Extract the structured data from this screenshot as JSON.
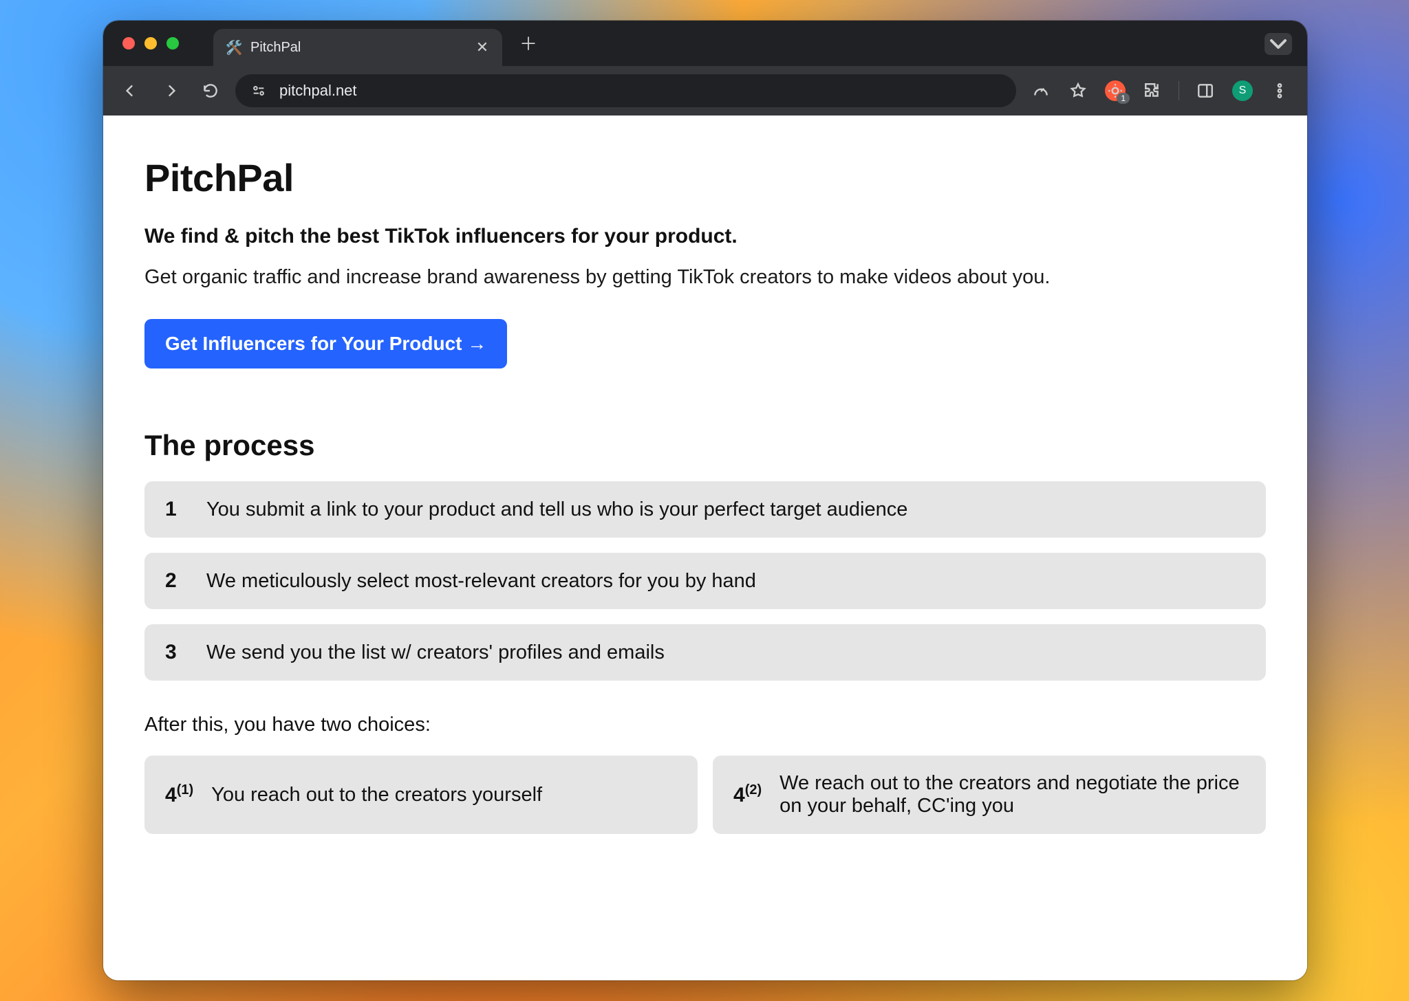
{
  "browser": {
    "tab_title": "PitchPal",
    "favicon_glyph": "🛠️",
    "url": "pitchpal.net",
    "ext_badge_count": "1",
    "profile_initial": "S"
  },
  "page": {
    "title": "PitchPal",
    "tagline": "We find & pitch the best TikTok influencers for your product.",
    "subtext": "Get organic traffic and increase brand awareness by getting TikTok creators to make videos about you.",
    "cta_label": "Get Influencers for Your Product →",
    "process_heading": "The process",
    "steps": [
      {
        "n": "1",
        "text": "You submit a link to your product and tell us who is your perfect target audience"
      },
      {
        "n": "2",
        "text": "We meticulously select most-relevant creators for you by hand"
      },
      {
        "n": "3",
        "text": "We send you the list w/ creators' profiles and emails"
      }
    ],
    "choices_label": "After this, you have two choices:",
    "choices": [
      {
        "n": "4",
        "sup": "(1)",
        "text": "You reach out to the creators yourself"
      },
      {
        "n": "4",
        "sup": "(2)",
        "text": "We reach out to the creators and negotiate the price on your behalf, CC'ing you"
      }
    ]
  }
}
